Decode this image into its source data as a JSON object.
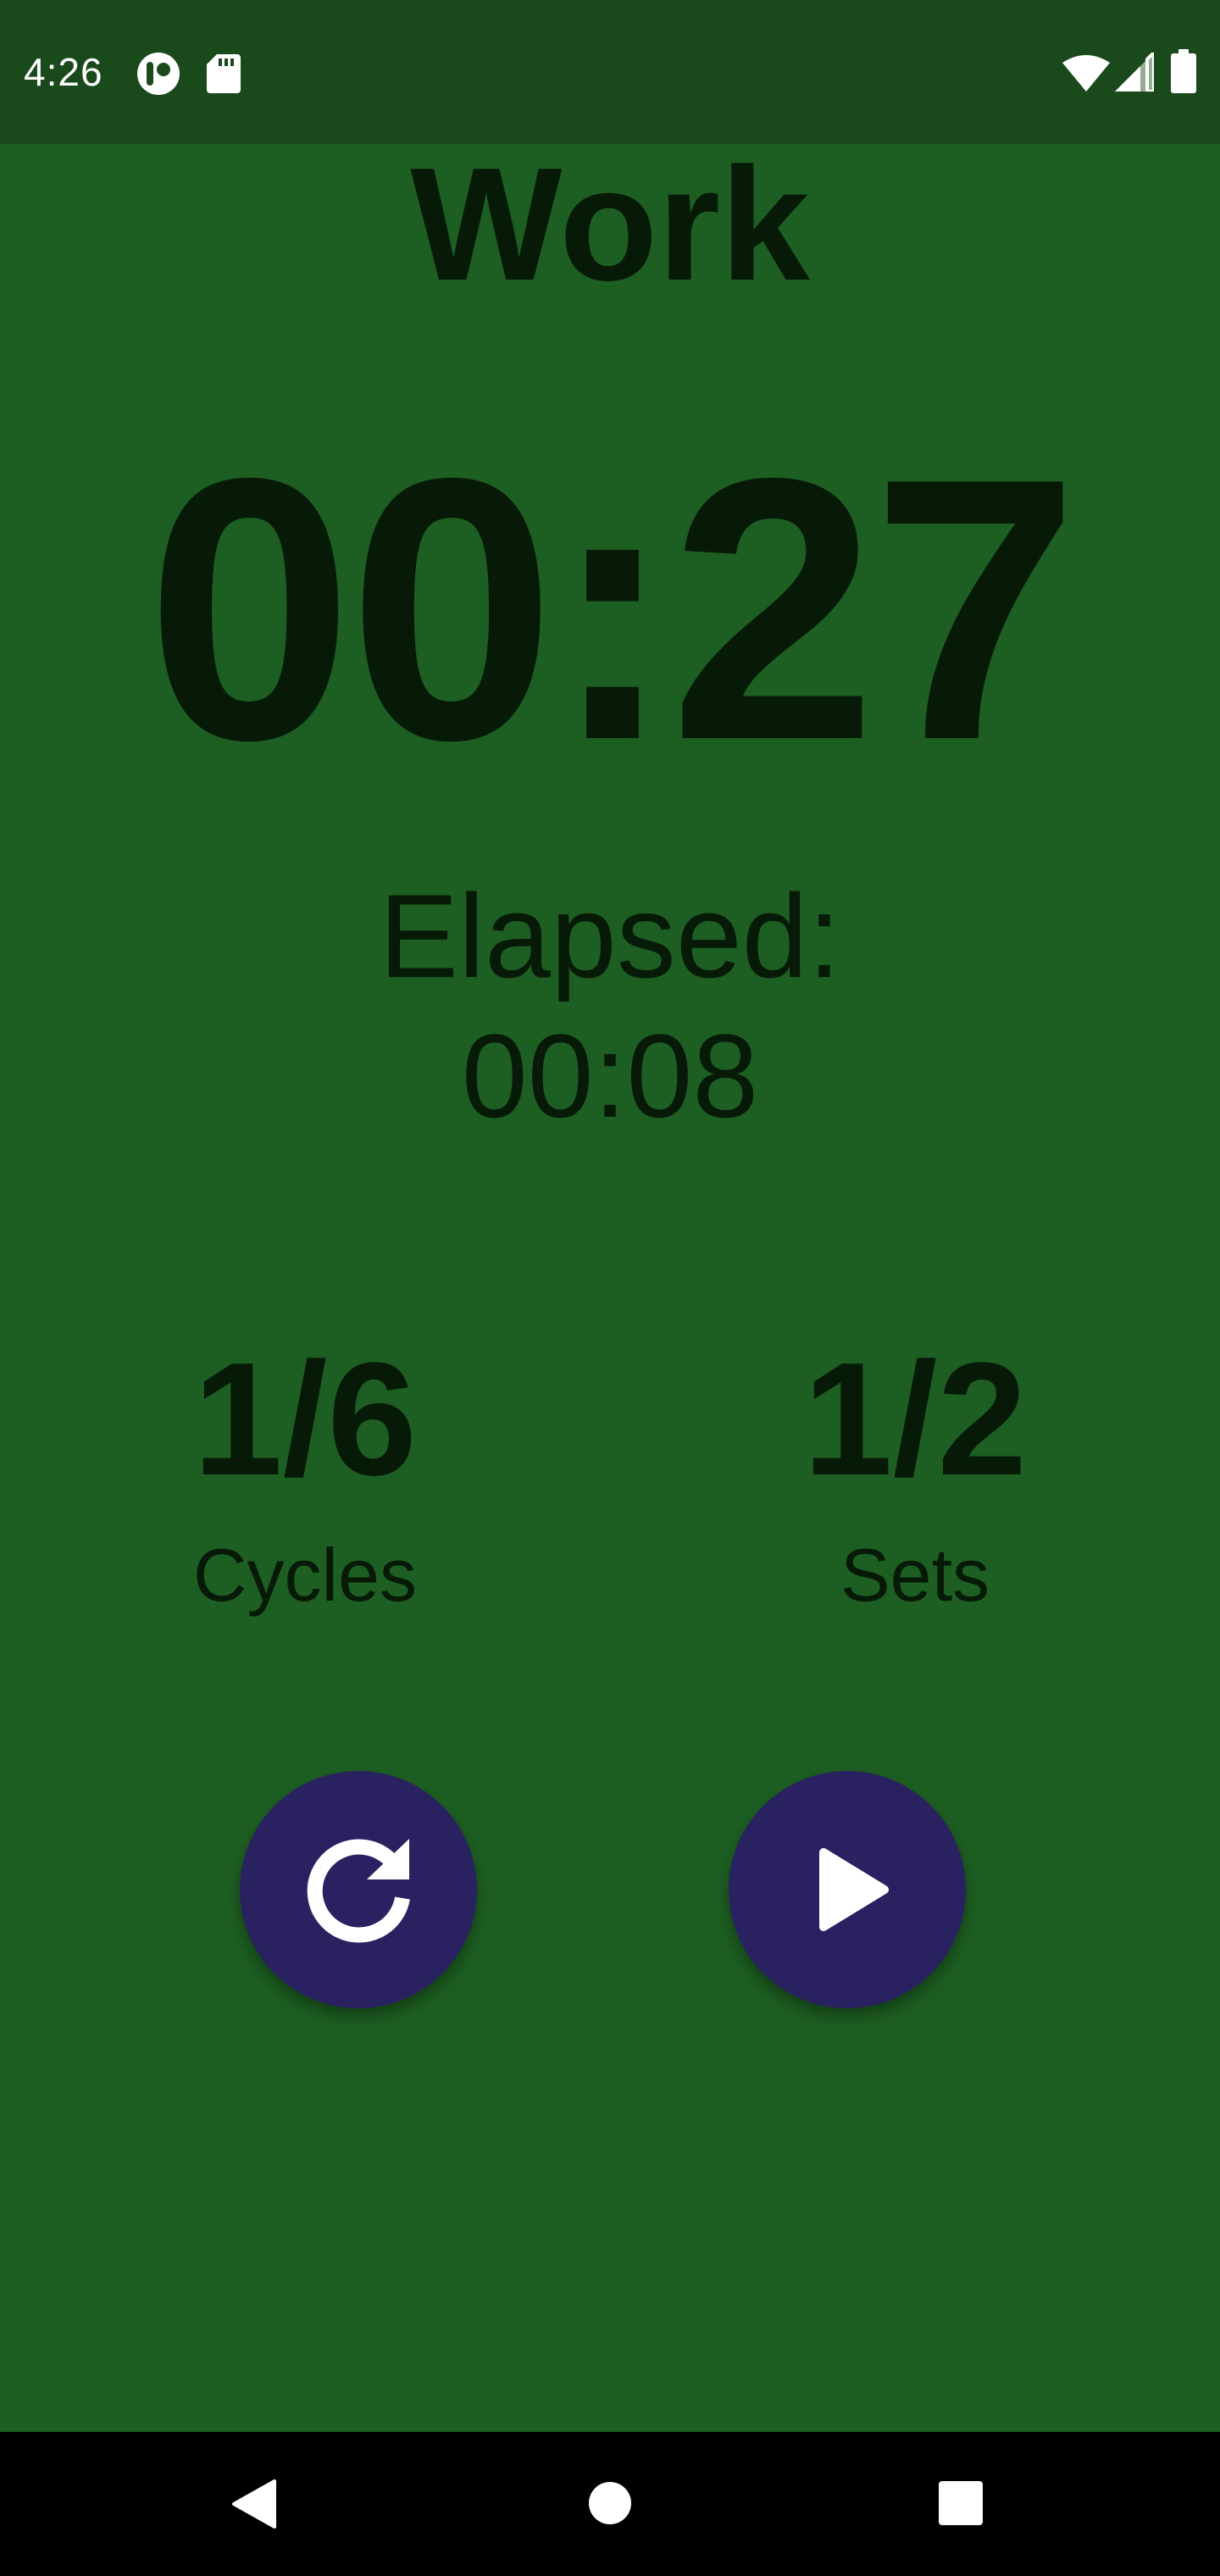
{
  "status_bar": {
    "time": "4:26",
    "icons": [
      "app-notification-icon",
      "sd-card-icon",
      "wifi-icon",
      "cell-signal-icon",
      "battery-icon"
    ]
  },
  "timer": {
    "phase": "Work",
    "remaining": "00:27",
    "elapsed_label": "Elapsed:",
    "elapsed_value": "00:08"
  },
  "stats": {
    "cycles": {
      "value": "1/6",
      "label": "Cycles"
    },
    "sets": {
      "value": "1/2",
      "label": "Sets"
    }
  },
  "controls": {
    "restart_icon": "restart-icon",
    "play_icon": "play-icon"
  },
  "navigation": {
    "buttons": [
      "back-icon",
      "home-icon",
      "recents-icon"
    ]
  },
  "colors": {
    "background": "#1d5f22",
    "status_bar": "#1a4a1c",
    "text": "#071a08",
    "fab": "#2a2160",
    "nav_bar": "#000000"
  }
}
